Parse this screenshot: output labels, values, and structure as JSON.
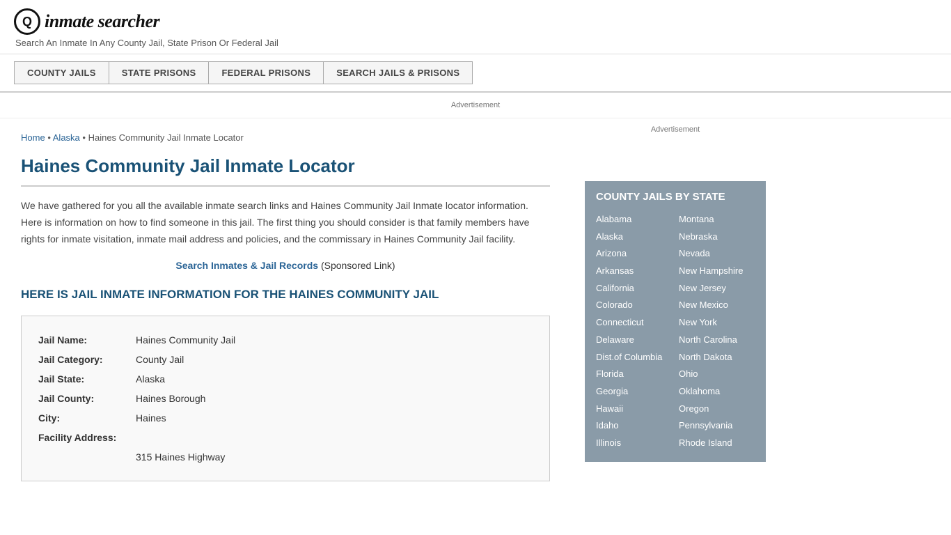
{
  "header": {
    "logo_icon": "🔍",
    "logo_text": "inmate searcher",
    "tagline": "Search An Inmate In Any County Jail, State Prison Or Federal Jail"
  },
  "nav": {
    "items": [
      {
        "label": "COUNTY JAILS",
        "id": "county-jails-nav"
      },
      {
        "label": "STATE PRISONS",
        "id": "state-prisons-nav"
      },
      {
        "label": "FEDERAL PRISONS",
        "id": "federal-prisons-nav"
      },
      {
        "label": "SEARCH JAILS & PRISONS",
        "id": "search-nav"
      }
    ]
  },
  "ad_label": "Advertisement",
  "breadcrumb": {
    "home": "Home",
    "state": "Alaska",
    "page": "Haines Community Jail Inmate Locator"
  },
  "page_title": "Haines Community Jail Inmate Locator",
  "description": "We have gathered for you all the available inmate search links and Haines Community Jail Inmate locator information. Here is information on how to find someone in this jail. The first thing you should consider is that family members have rights for inmate visitation, inmate mail address and policies, and the commissary in Haines Community Jail facility.",
  "sponsored": {
    "link_text": "Search Inmates & Jail Records",
    "note": "(Sponsored Link)"
  },
  "info_heading": "HERE IS JAIL INMATE INFORMATION FOR THE HAINES COMMUNITY JAIL",
  "jail_info": {
    "name_label": "Jail Name:",
    "name_value": "Haines Community Jail",
    "category_label": "Jail Category:",
    "category_value": "County Jail",
    "state_label": "Jail State:",
    "state_value": "Alaska",
    "county_label": "Jail County:",
    "county_value": "Haines Borough",
    "city_label": "City:",
    "city_value": "Haines",
    "address_label": "Facility Address:",
    "address_value": "315 Haines Highway"
  },
  "sidebar": {
    "ad_label": "Advertisement",
    "county_jails_title": "COUNTY JAILS BY STATE",
    "states_col1": [
      "Alabama",
      "Alaska",
      "Arizona",
      "Arkansas",
      "California",
      "Colorado",
      "Connecticut",
      "Delaware",
      "Dist.of Columbia",
      "Florida",
      "Georgia",
      "Hawaii",
      "Idaho",
      "Illinois"
    ],
    "states_col2": [
      "Montana",
      "Nebraska",
      "Nevada",
      "New Hampshire",
      "New Jersey",
      "New Mexico",
      "New York",
      "North Carolina",
      "North Dakota",
      "Ohio",
      "Oklahoma",
      "Oregon",
      "Pennsylvania",
      "Rhode Island"
    ]
  }
}
